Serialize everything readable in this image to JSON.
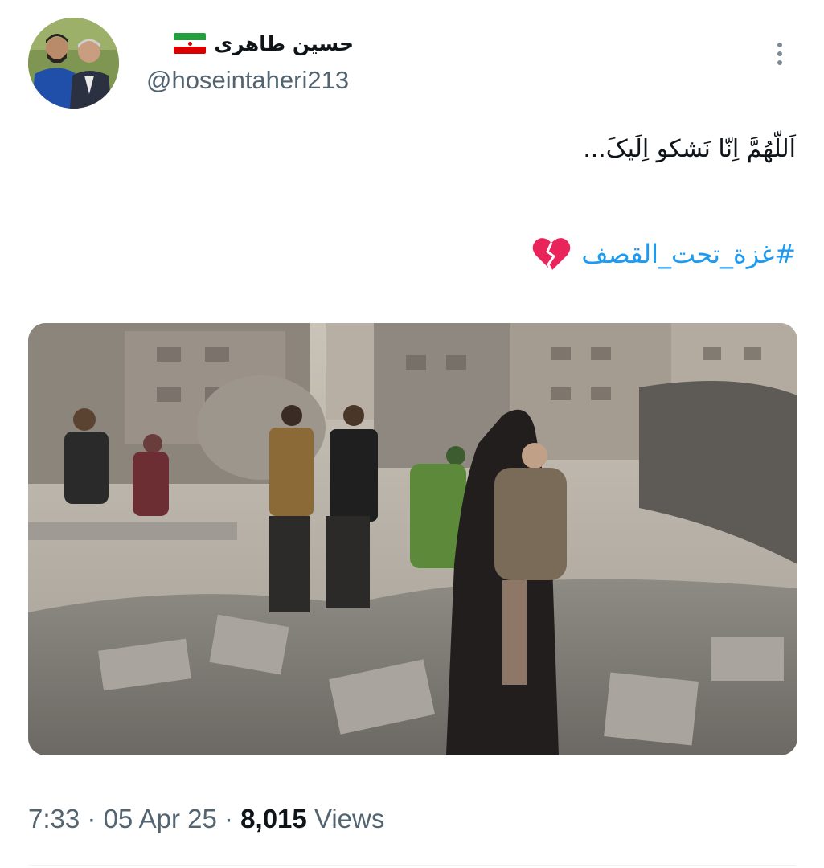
{
  "author": {
    "display_name": "حسین طاهری",
    "handle": "@hoseintaheri213",
    "flag_icon": "iran-flag-icon"
  },
  "tweet": {
    "text_line1": "اَللّهُمَّ اِنّا نَشکو اِلَیکَ...",
    "hashtag": "#غزة_تحت_القصف",
    "emoji": "broken-heart-icon"
  },
  "meta": {
    "time": "7:33",
    "separator": " · ",
    "date": "05 Apr 25",
    "views_count": "8,015",
    "views_label": "Views"
  },
  "colors": {
    "link": "#1d9bf0",
    "text": "#0f1419",
    "secondary": "#536471"
  }
}
